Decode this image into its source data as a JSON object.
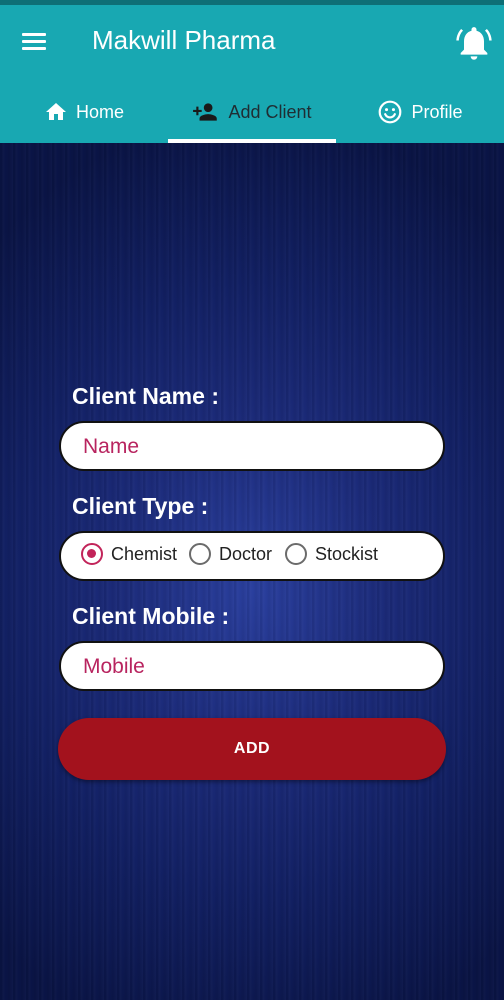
{
  "app": {
    "title": "Makwill Pharma"
  },
  "tabs": [
    {
      "label": "Home",
      "icon": "home-icon"
    },
    {
      "label": "Add Client",
      "icon": "add-person-icon"
    },
    {
      "label": "Profile",
      "icon": "smiley-icon"
    }
  ],
  "active_tab": "Add Client",
  "form": {
    "client_name_label": "Client Name :",
    "client_name_placeholder": "Name",
    "client_type_label": "Client Type :",
    "client_types": [
      "Chemist",
      "Doctor",
      "Stockist"
    ],
    "client_type_selected": "Chemist",
    "client_mobile_label": "Client Mobile :",
    "client_mobile_placeholder": "Mobile",
    "submit_label": "ADD"
  },
  "colors": {
    "header": "#18a8b2",
    "accent": "#c2245a",
    "button": "#a3121d",
    "background": "#1c2b7a"
  }
}
